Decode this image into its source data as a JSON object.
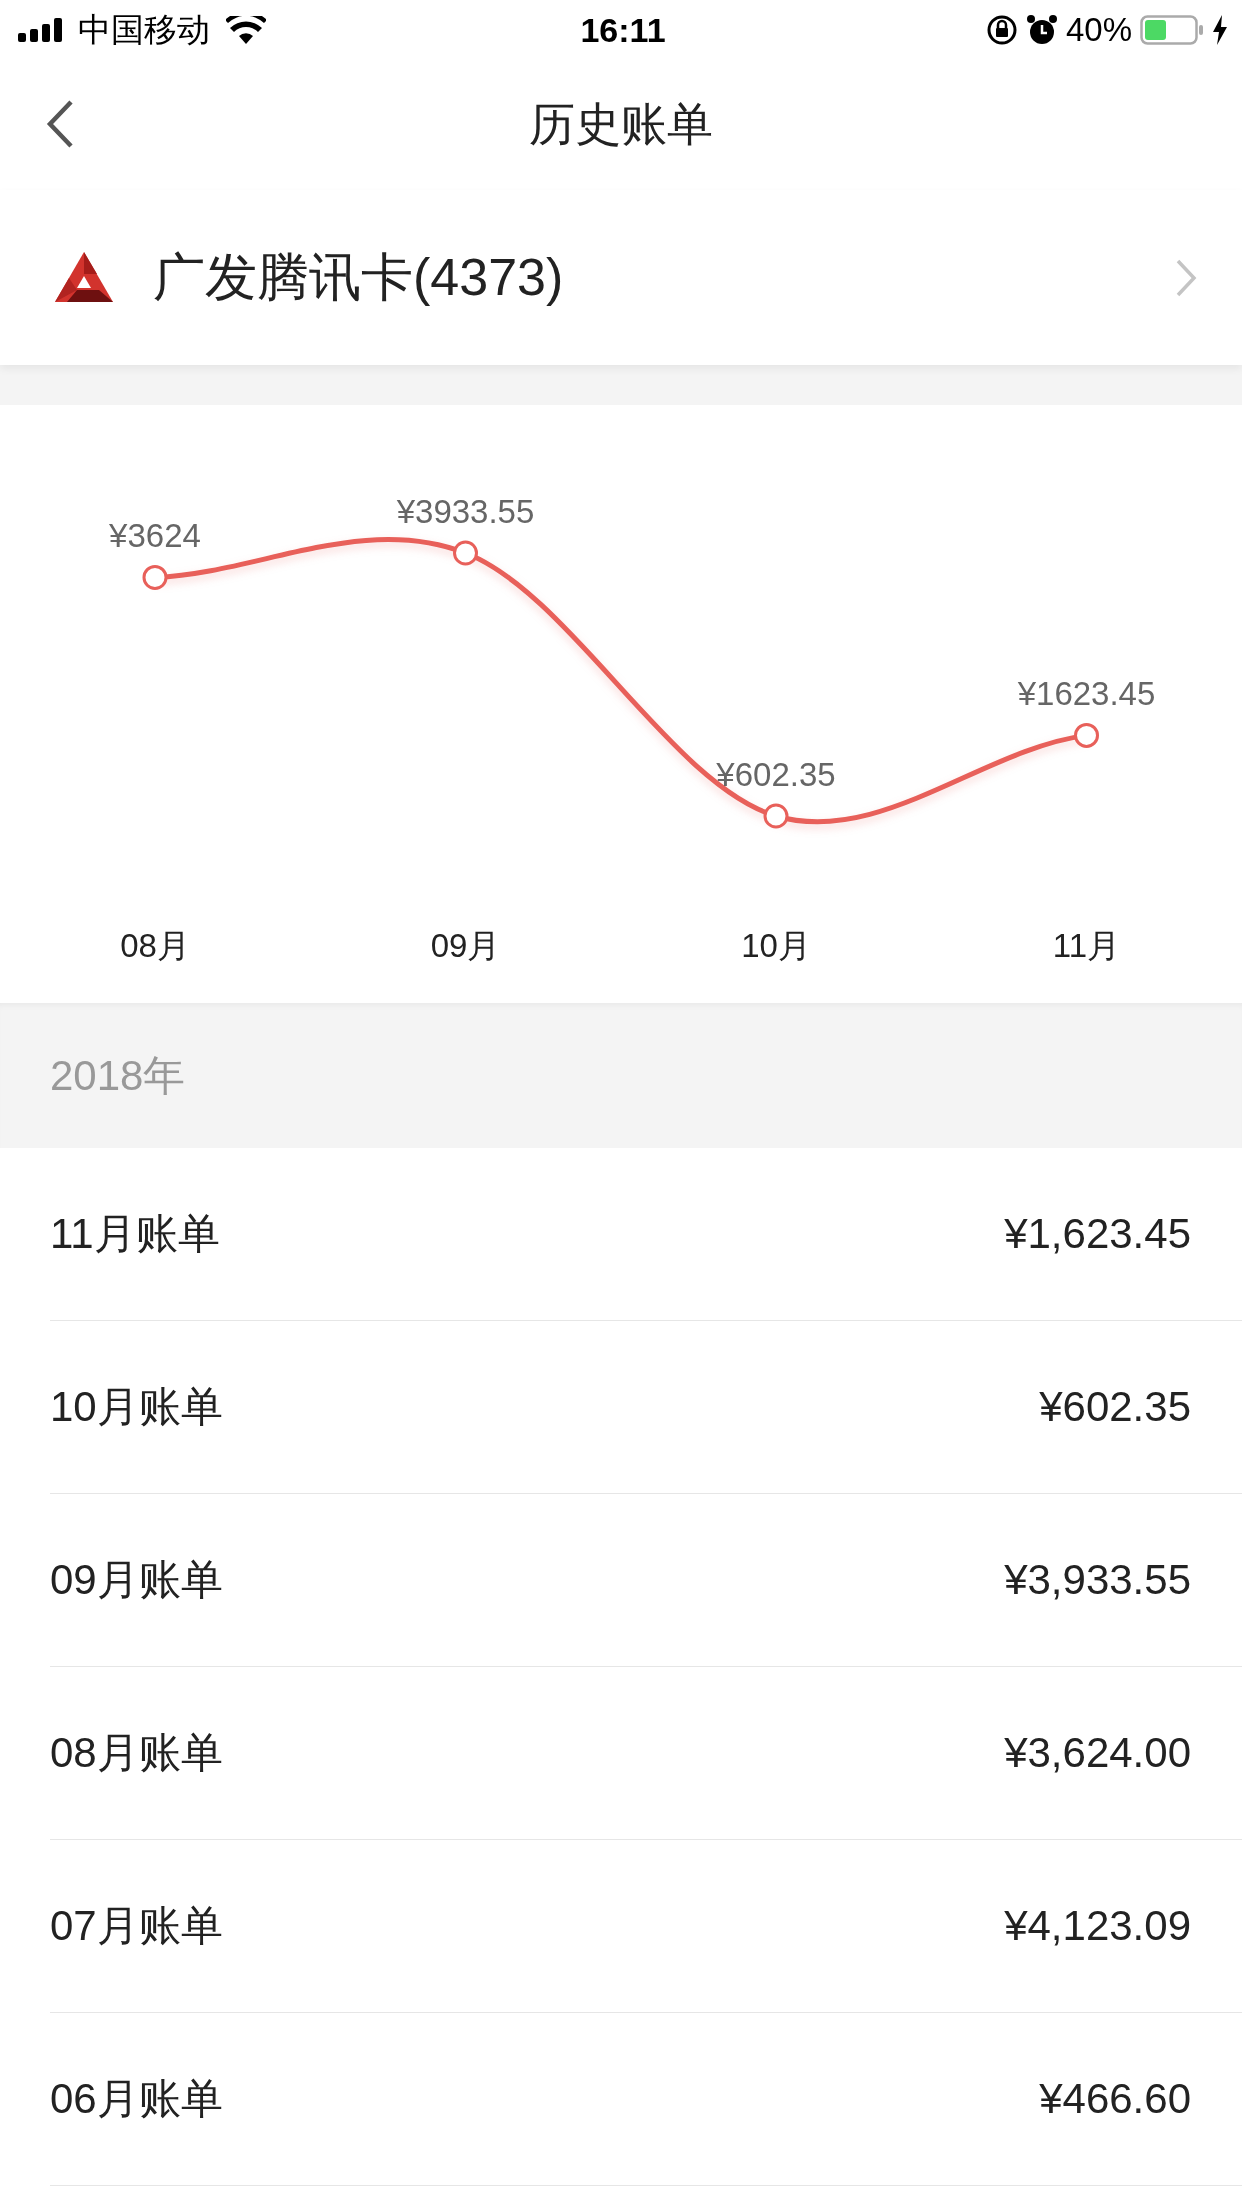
{
  "status_bar": {
    "carrier": "中国移动",
    "time": "16:11",
    "battery": "40%"
  },
  "nav": {
    "title": "历史账单"
  },
  "card": {
    "name": "广发腾讯卡(4373)"
  },
  "chart": {
    "chart_data": {
      "type": "line",
      "categories": [
        "08月",
        "09月",
        "10月",
        "11月"
      ],
      "series": [
        {
          "color": "#e8605a",
          "marker": "circle",
          "values": [
            3624,
            3933.55,
            602.35,
            1623.45
          ],
          "value_labels": [
            "¥3624",
            "¥3933.55",
            "¥602.35",
            "¥1623.45"
          ]
        }
      ]
    }
  },
  "year": "2018年",
  "bills": [
    {
      "label": "11月账单",
      "amount": "¥1,623.45"
    },
    {
      "label": "10月账单",
      "amount": "¥602.35"
    },
    {
      "label": "09月账单",
      "amount": "¥3,933.55"
    },
    {
      "label": "08月账单",
      "amount": "¥3,624.00"
    },
    {
      "label": "07月账单",
      "amount": "¥4,123.09"
    },
    {
      "label": "06月账单",
      "amount": "¥466.60"
    }
  ]
}
